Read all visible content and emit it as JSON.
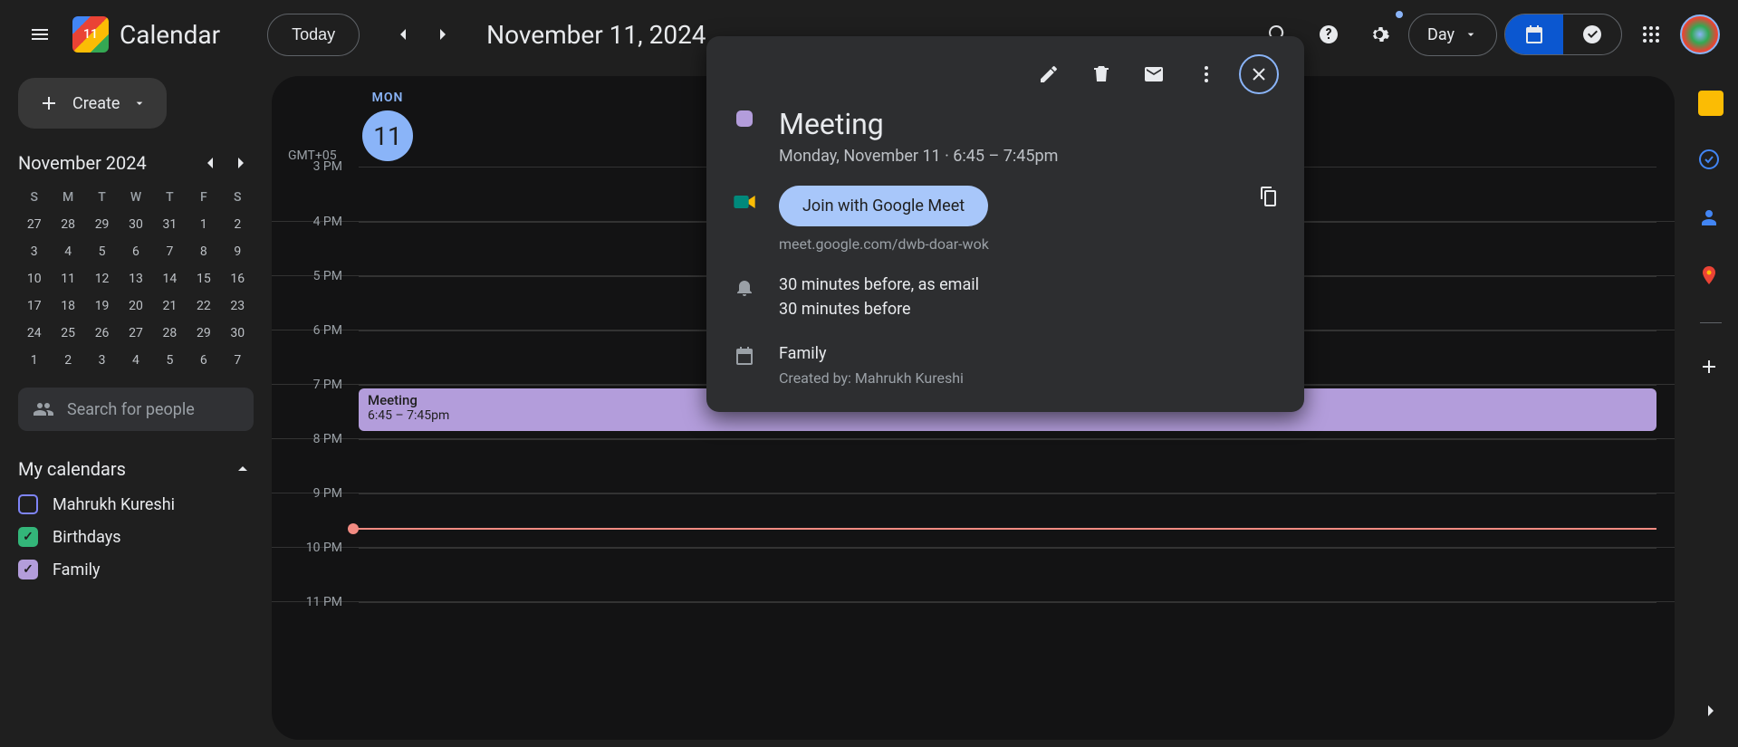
{
  "header": {
    "app_name": "Calendar",
    "logo_day": "11",
    "today_label": "Today",
    "title": "November 11, 2024",
    "view_label": "Day"
  },
  "create": {
    "label": "Create"
  },
  "minical": {
    "title": "November 2024",
    "dow": [
      "S",
      "M",
      "T",
      "W",
      "T",
      "F",
      "S"
    ],
    "weeks": [
      [
        "27",
        "28",
        "29",
        "30",
        "31",
        "1",
        "2"
      ],
      [
        "3",
        "4",
        "5",
        "6",
        "7",
        "8",
        "9"
      ],
      [
        "10",
        "11",
        "12",
        "13",
        "14",
        "15",
        "16"
      ],
      [
        "17",
        "18",
        "19",
        "20",
        "21",
        "22",
        "23"
      ],
      [
        "24",
        "25",
        "26",
        "27",
        "28",
        "29",
        "30"
      ],
      [
        "1",
        "2",
        "3",
        "4",
        "5",
        "6",
        "7"
      ]
    ],
    "today": "11"
  },
  "search_placeholder": "Search for people",
  "my_calendars": {
    "title": "My calendars",
    "items": [
      {
        "label": "Mahrukh Kureshi",
        "color": "#7e84f7",
        "checked": false
      },
      {
        "label": "Birthdays",
        "color": "#33b679",
        "checked": true
      },
      {
        "label": "Family",
        "color": "#b39ddb",
        "checked": true
      }
    ]
  },
  "dayview": {
    "tz": "GMT+05",
    "dow": "MON",
    "daynum": "11",
    "hours": [
      "3 PM",
      "4 PM",
      "5 PM",
      "6 PM",
      "7 PM",
      "8 PM",
      "9 PM",
      "10 PM",
      "11 PM"
    ],
    "event": {
      "title": "Meeting",
      "time": "6:45 – 7:45pm"
    }
  },
  "popup": {
    "title": "Meeting",
    "when": "Monday, November 11  ·  6:45 – 7:45pm",
    "meet_label": "Join with Google Meet",
    "meet_link": "meet.google.com/dwb-doar-wok",
    "reminder1": "30 minutes before, as email",
    "reminder2": "30 minutes before",
    "calendar": "Family",
    "creator": "Created by: Mahrukh Kureshi"
  }
}
